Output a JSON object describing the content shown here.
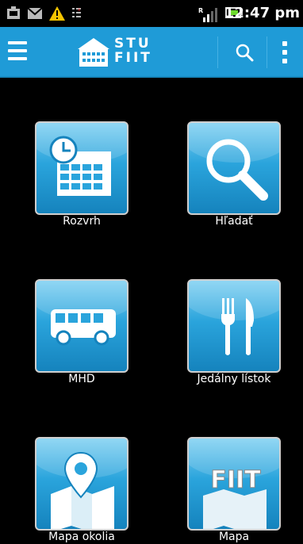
{
  "status_bar": {
    "time": "12:47 pm",
    "icons": [
      "notification-icon",
      "gmail-icon",
      "warning-icon",
      "sim-icon",
      "signal-icon",
      "battery-icon"
    ]
  },
  "action_bar": {
    "logo_line1": "STU",
    "logo_line2": "FIIT",
    "color": "#1f9bd7"
  },
  "tiles": [
    {
      "label": "Rozvrh",
      "icon": "calendar-clock-icon"
    },
    {
      "label": "Hľadať",
      "icon": "magnifier-icon"
    },
    {
      "label": "MHD",
      "icon": "bus-icon"
    },
    {
      "label": "Jedálny lístok",
      "icon": "fork-knife-icon"
    },
    {
      "label": "Mapa okolia",
      "icon": "map-pin-icon"
    },
    {
      "label": "Mapa",
      "icon": "fiit-building-icon"
    }
  ]
}
